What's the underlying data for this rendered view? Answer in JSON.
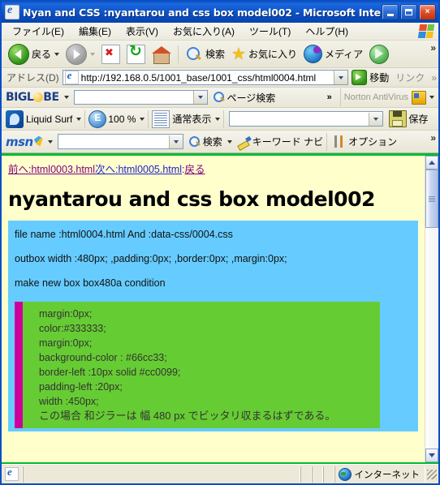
{
  "window": {
    "title": "Nyan and CSS :nyantarou and css box model002 - Microsoft Inte...",
    "minimize_label": "Minimize",
    "maximize_label": "Maximize",
    "close_label": "×"
  },
  "menubar": {
    "items": [
      {
        "label": "ファイル(E)"
      },
      {
        "label": "編集(E)"
      },
      {
        "label": "表示(V)"
      },
      {
        "label": "お気に入り(A)"
      },
      {
        "label": "ツール(T)"
      },
      {
        "label": "ヘルプ(H)"
      }
    ]
  },
  "toolbar": {
    "back_label": "戻る",
    "forward_label": "",
    "stop_label": "",
    "refresh_label": "",
    "home_label": "",
    "search_label": "検索",
    "favorites_label": "お気に入り",
    "media_label": "メディア",
    "history_label": "",
    "overflow_label": "»"
  },
  "address": {
    "label": "アドレス(D)",
    "url": "http://192.168.0.5/1001_base/1001_css/html0004.html",
    "go_label": "移動",
    "links_label": "リンク",
    "overflow_label": "»"
  },
  "biglobe": {
    "brand_prefix": "BIGL",
    "brand_suffix": "BE",
    "search_value": "",
    "page_search_label": "ページ検索",
    "overflow_label": "»",
    "norton_label": "Norton AntiVirus"
  },
  "liquidsurf": {
    "name_label": "Liquid Surf",
    "zoom_label": "100 %",
    "view_label": "通常表示",
    "field_value": "",
    "save_label": "保存"
  },
  "msn": {
    "brand_label": "msn",
    "search_value": "",
    "search_label": "検索",
    "keyword_navi_label": "キーワード ナビ",
    "options_label": "オプション",
    "overflow_label": "»"
  },
  "page": {
    "nav": {
      "prev_label": "前へ:html0003.html",
      "next_label": "次へ:html0005.html",
      "sep": ":",
      "back_label": "戻る"
    },
    "title": "nyantarou and css box model002",
    "bluebox": [
      "file name :html0004.html And :data-css/0004.css",
      "outbox width :480px; ,padding:0px; ,border:0px; ,margin:0px;",
      "make new box box480a condition"
    ],
    "greenbox": [
      "margin:0px;",
      "color:#333333;",
      "margin:0px;",
      "background-color : #66cc33;",
      "border-left :10px solid #cc0099;",
      "padding-left :20px;",
      "width :450px;",
      "この場合 和ジラーは 幅 480 px でビッタリ収まるはずである。"
    ]
  },
  "statusbar": {
    "zone_label": "インターネット"
  },
  "colors": {
    "page_bg": "#ffffcc",
    "frame_green": "#00bb33",
    "bluebox_bg": "#66ccff",
    "greenbox_bg": "#66cc33",
    "greenbox_border": "#cc0099",
    "greenbox_text": "#333333",
    "title_bar": "#0b4fc4"
  }
}
